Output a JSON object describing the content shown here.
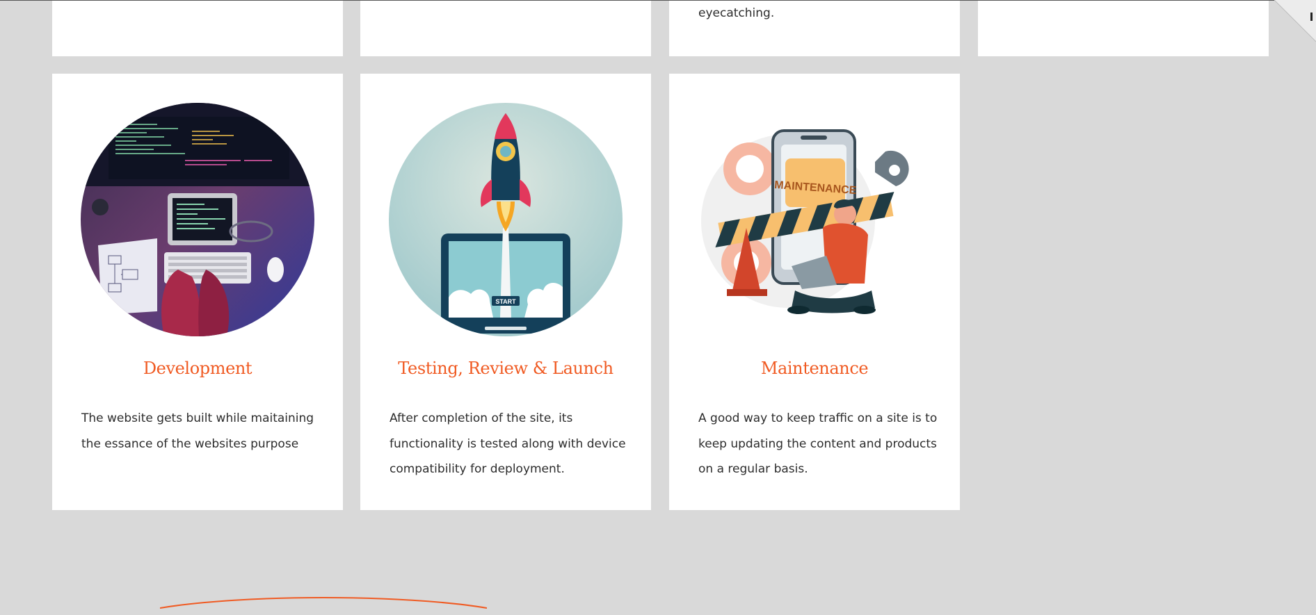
{
  "process_cards": {
    "top_row": [
      {
        "text": ""
      },
      {
        "text": ""
      },
      {
        "text": "eyecatching."
      },
      {
        "text": ""
      }
    ],
    "steps": [
      {
        "title": "Development",
        "description": "The website gets built while maitaining the essance of the websites purpose",
        "image": "developer-desk-photo"
      },
      {
        "title": "Testing, Review & Launch",
        "description": "After completion of the site, its functionality is tested along with device compatibility for deployment.",
        "image": "rocket-launch-laptop-illustration",
        "image_label": "START"
      },
      {
        "title": "Maintenance",
        "description": "A good way to keep traffic on a site is to keep updating the content and products on a regular basis.",
        "image": "maintenance-worker-illustration",
        "image_label": "MAINTENANCE"
      }
    ]
  },
  "colors": {
    "accent": "#f05a22",
    "page_bg": "#d9d9d9",
    "card_bg": "#ffffff",
    "body_text": "#2c2c2c"
  }
}
